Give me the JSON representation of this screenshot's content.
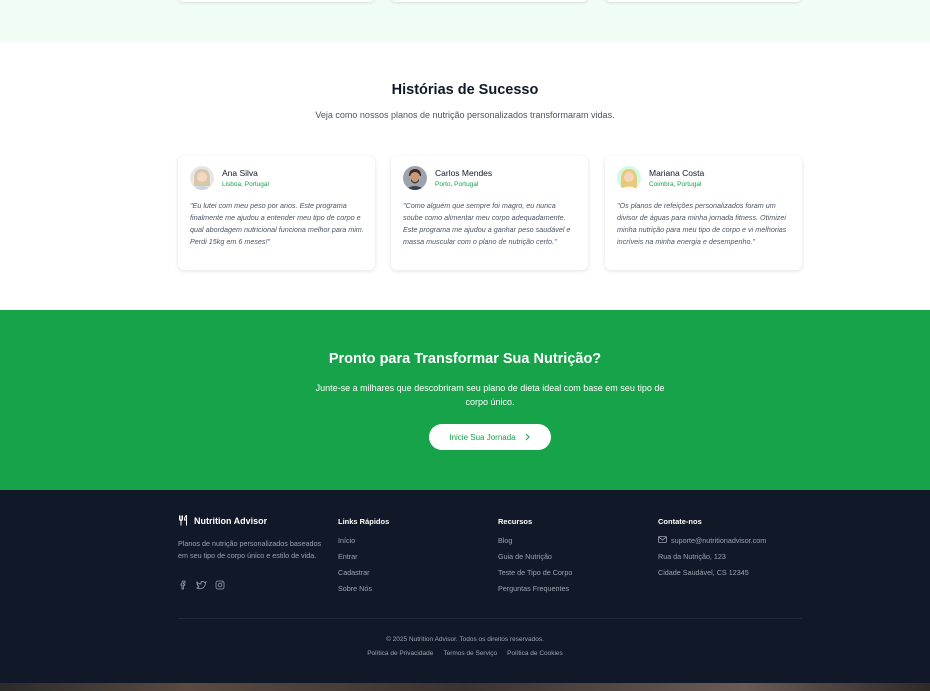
{
  "stories": {
    "title": "Histórias de Sucesso",
    "subtitle": "Veja como nossos planos de nutrição personalizados transformaram vidas.",
    "testimonials": [
      {
        "name": "Ana Silva",
        "location": "Lisboa, Portugal",
        "quote": "\"Eu lutei com meu peso por anos. Este programa finalmente me ajudou a entender meu tipo de corpo e qual abordagem nutricional funciona melhor para mim. Perdi 15kg em 6 meses!\""
      },
      {
        "name": "Carlos Mendes",
        "location": "Porto, Portugal",
        "quote": "\"Como alguém que sempre foi magro, eu nunca soube como alimentar meu corpo adequadamente. Este programa me ajudou a ganhar peso saudável e massa muscular com o plano de nutrição certo.\""
      },
      {
        "name": "Mariana Costa",
        "location": "Coimbra, Portugal",
        "quote": "\"Os planos de refeições personalizados foram um divisor de águas para minha jornada fitness. Otimizei minha nutrição para meu tipo de corpo e vi melhorias incríveis na minha energia e desempenho.\""
      }
    ]
  },
  "cta": {
    "title": "Pronto para Transformar Sua Nutrição?",
    "text": "Junte-se a milhares que descobriram seu plano de dieta ideal com base em seu tipo de corpo único.",
    "button": "Inicie Sua Jornada"
  },
  "footer": {
    "brand": "Nutrition Advisor",
    "description": "Planos de nutrição personalizados baseados em seu tipo de corpo único e estilo de vida.",
    "quick_links": {
      "title": "Links Rápidos",
      "items": [
        "Início",
        "Entrar",
        "Cadastrar",
        "Sobre Nós"
      ]
    },
    "resources": {
      "title": "Recursos",
      "items": [
        "Blog",
        "Guia de Nutrição",
        "Teste de Tipo de Corpo",
        "Perguntas Frequentes"
      ]
    },
    "contact": {
      "title": "Contate-nos",
      "email": "suporte@nutritionadvisor.com",
      "address1": "Rua da Nutrição, 123",
      "address2": "Cidade Saudável, CS 12345"
    },
    "copyright": "© 2025 Nutrition Advisor. Todos os direitos reservados.",
    "legal": [
      "Política de Privacidade",
      "Termos de Serviço",
      "Política de Cookies"
    ]
  },
  "colors": {
    "accent": "#16a34a",
    "footer_bg": "#111827",
    "light_green_bg": "#f0fdf4"
  },
  "icons": [
    "utensils-icon",
    "chevron-right-icon",
    "facebook-icon",
    "twitter-icon",
    "instagram-icon",
    "mail-icon"
  ]
}
